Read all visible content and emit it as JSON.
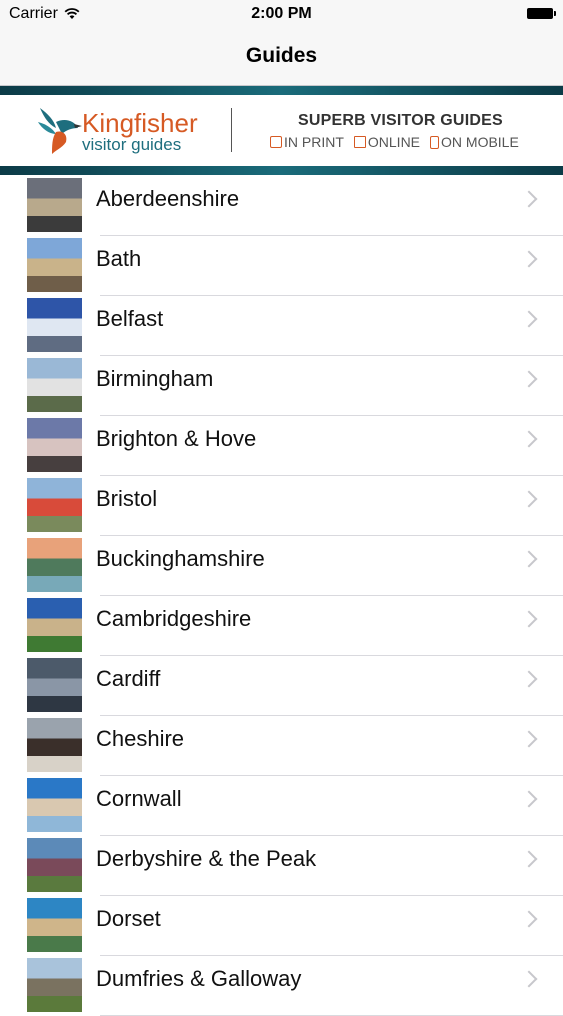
{
  "status": {
    "carrier": "Carrier",
    "time": "2:00 PM"
  },
  "nav": {
    "title": "Guides"
  },
  "banner": {
    "brand": "Kingfisher",
    "brand_sub": "visitor guides",
    "tagline": "SUPERB VISITOR GUIDES",
    "media": [
      "IN PRINT",
      "ONLINE",
      "ON MOBILE"
    ]
  },
  "colors": {
    "accent": "#d65a24",
    "teal": "#1e6e7e",
    "stripe": "#0c3b47"
  },
  "guides": [
    {
      "label": "Aberdeenshire",
      "thumb": [
        "#6b6f7a",
        "#b8a98c",
        "#3b3b3b"
      ]
    },
    {
      "label": "Bath",
      "thumb": [
        "#7ea7d8",
        "#c9b38a",
        "#6f5e49"
      ]
    },
    {
      "label": "Belfast",
      "thumb": [
        "#2e55a8",
        "#dfe7f2",
        "#5f6c82"
      ]
    },
    {
      "label": "Birmingham",
      "thumb": [
        "#9ab8d6",
        "#e2e2e2",
        "#5b6b4a"
      ]
    },
    {
      "label": "Brighton & Hove",
      "thumb": [
        "#6c79a8",
        "#d7c3c0",
        "#473f3f"
      ]
    },
    {
      "label": "Bristol",
      "thumb": [
        "#8fb4d9",
        "#d84b3a",
        "#7a8a5c"
      ]
    },
    {
      "label": "Buckinghamshire",
      "thumb": [
        "#e8a27a",
        "#4f7a5c",
        "#78a9b8"
      ]
    },
    {
      "label": "Cambridgeshire",
      "thumb": [
        "#2a5fb0",
        "#c9b28a",
        "#3f7a33"
      ]
    },
    {
      "label": "Cardiff",
      "thumb": [
        "#4c5a6a",
        "#8a96a6",
        "#2e3743"
      ]
    },
    {
      "label": "Cheshire",
      "thumb": [
        "#9aa3ad",
        "#3a2f2a",
        "#d8d2c8"
      ]
    },
    {
      "label": "Cornwall",
      "thumb": [
        "#2a78c7",
        "#d9c8b0",
        "#8fb7d8"
      ]
    },
    {
      "label": "Derbyshire & the Peak",
      "thumb": [
        "#5c8ab8",
        "#7a4a5a",
        "#5a7a3e"
      ]
    },
    {
      "label": "Dorset",
      "thumb": [
        "#2d86c4",
        "#cfb58a",
        "#4a7a4a"
      ]
    },
    {
      "label": "Dumfries & Galloway",
      "thumb": [
        "#a9c3db",
        "#7a7260",
        "#5b7a3b"
      ]
    }
  ]
}
